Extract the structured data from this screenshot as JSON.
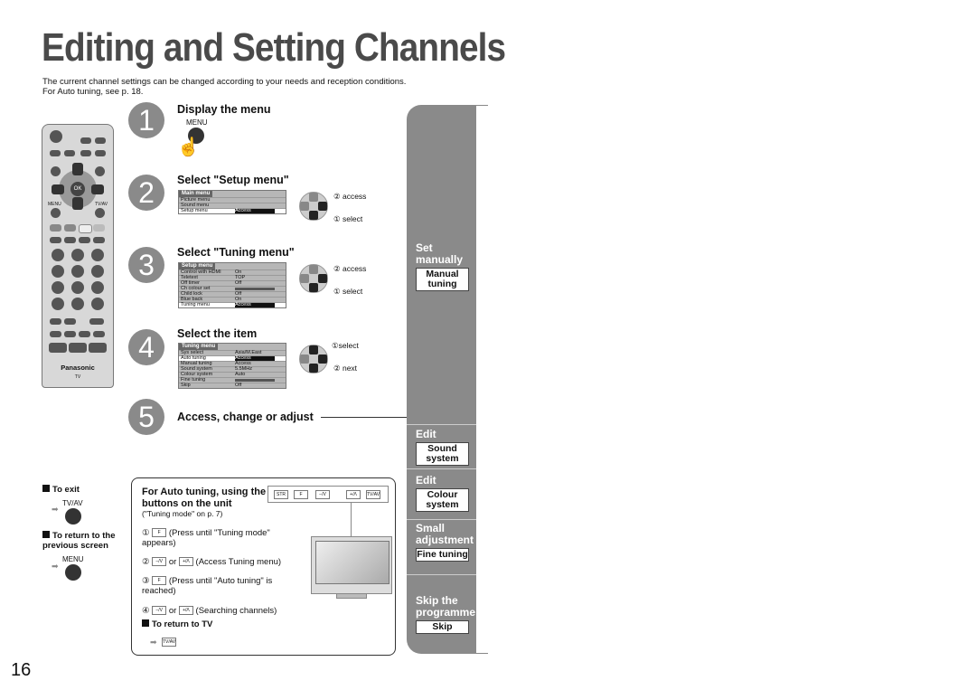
{
  "page": {
    "title": "Editing and Setting Channels",
    "intro_line1": "The current channel settings can be changed according to your needs and reception conditions.",
    "intro_line2": "For Auto tuning, see p. 18.",
    "page_number": "16"
  },
  "remote": {
    "brand": "Panasonic",
    "sub": "TV",
    "ok": "OK",
    "menu": "MENU",
    "tvav": "TV/AV"
  },
  "steps": [
    {
      "num": "1",
      "title": "Display the menu",
      "button": "MENU"
    },
    {
      "num": "2",
      "title": "Select \"Setup menu\"",
      "osd": {
        "header": "Main menu",
        "rows": [
          [
            "Picture menu",
            ""
          ],
          [
            "Sound menu",
            ""
          ],
          [
            "Setup menu",
            "Access"
          ]
        ]
      },
      "access": "② access",
      "select": "① select"
    },
    {
      "num": "3",
      "title": "Select \"Tuning menu\"",
      "osd": {
        "header": "Setup menu",
        "rows": [
          [
            "Control with HDMI",
            "On"
          ],
          [
            "Teletext",
            "TOP"
          ],
          [
            "Off timer",
            "Off"
          ],
          [
            "Ch colour set",
            ""
          ],
          [
            "Child lock",
            "Off"
          ],
          [
            "Blue back",
            "On"
          ],
          [
            "Tuning menu",
            "Access"
          ]
        ]
      },
      "access": "② access",
      "select": "① select"
    },
    {
      "num": "4",
      "title": "Select the item",
      "osd": {
        "header": "Tuning menu",
        "rows": [
          [
            "Sys select",
            "Asia/M.East"
          ],
          [
            "Auto tuning",
            "Access"
          ],
          [
            "Manual tuning",
            "Access"
          ],
          [
            "Sound system",
            "5.5MHz"
          ],
          [
            "Colour system",
            "Auto"
          ],
          [
            "Fine tuning",
            ""
          ],
          [
            "Skip",
            "Off"
          ]
        ]
      },
      "select": "①select",
      "next": "② next"
    },
    {
      "num": "5",
      "title": "Access, change or adjust"
    }
  ],
  "exit": {
    "to_exit": "To exit",
    "tvav": "TV/AV",
    "return_prev": "To return to the previous screen",
    "menu": "MENU"
  },
  "auto_box": {
    "title": "For Auto tuning, using the buttons on the unit",
    "note": "(\"Tuning mode\" on p. 7)",
    "unit_keys": [
      "STR",
      "F",
      "−/V",
      "+/Λ",
      "TV/AV"
    ],
    "items": [
      {
        "num": "①",
        "keys": [
          "F"
        ],
        "text": "(Press until \"Tuning mode\" appears)"
      },
      {
        "num": "②",
        "keys": [
          "−/V",
          "+/Λ"
        ],
        "or": "or",
        "text": "(Access Tuning menu)"
      },
      {
        "num": "③",
        "keys": [
          "F"
        ],
        "text": "(Press until \"Auto tuning\" is reached)"
      },
      {
        "num": "④",
        "keys": [
          "−/V",
          "+/Λ"
        ],
        "or": "or",
        "text": "(Searching channels)"
      }
    ],
    "return_tv": "To return to TV",
    "return_key": "TV/AV"
  },
  "sidebar": [
    {
      "caption": "Set manually",
      "button": "Manual tuning"
    },
    {
      "caption": "Edit",
      "button": "Sound system"
    },
    {
      "caption": "Edit",
      "button": "Colour system"
    },
    {
      "caption": "Small adjustment",
      "button": "Fine tuning"
    },
    {
      "caption": "Skip the programme",
      "button": "Skip"
    }
  ]
}
